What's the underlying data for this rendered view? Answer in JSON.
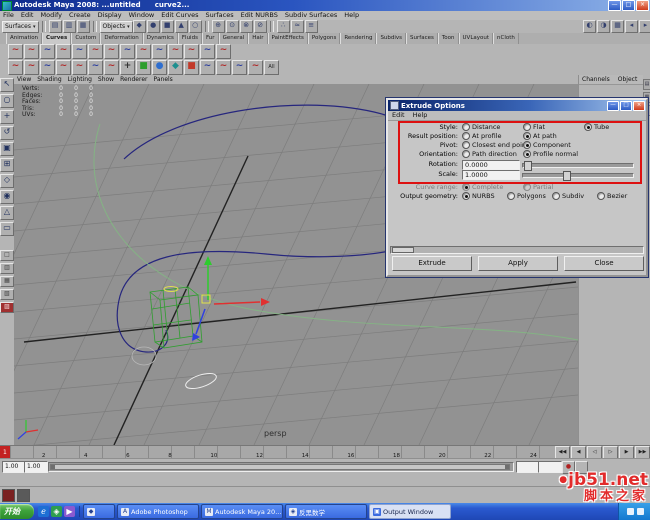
{
  "window": {
    "title": "Autodesk Maya 2008: ...untitled",
    "doc": "curve2...",
    "min_icon": "—",
    "max_icon": "□",
    "close_icon": "×"
  },
  "menubar": {
    "items": [
      "File",
      "Edit",
      "Modify",
      "Create",
      "Display",
      "Window",
      "Edit Curves",
      "Surfaces",
      "Edit NURBS",
      "Subdiv Surfaces",
      "Help"
    ]
  },
  "statusline": {
    "mode": "Surfaces",
    "mask": "Objects",
    "caret": "▾",
    "file_icons": [
      {
        "g": "▤"
      },
      {
        "g": "▥"
      },
      {
        "g": "▦"
      }
    ],
    "mask_icons": [
      {
        "g": "◆"
      },
      {
        "g": "●"
      },
      {
        "g": "■"
      },
      {
        "g": "▲"
      },
      {
        "g": "○"
      }
    ],
    "snap_icons": [
      {
        "g": "⊕"
      },
      {
        "g": "⊙"
      },
      {
        "g": "⊗"
      },
      {
        "g": "⊘"
      }
    ],
    "history_icons": [
      {
        "g": "∴"
      },
      {
        "g": "≈"
      },
      {
        "g": "≡"
      }
    ],
    "render_icons": [
      {
        "g": "◐"
      },
      {
        "g": "◑"
      },
      {
        "g": "▦"
      }
    ],
    "toggle_icons": [
      {
        "g": "◂"
      },
      {
        "g": "▸"
      }
    ]
  },
  "shelf": {
    "tabs": [
      {
        "t": "Animation"
      },
      {
        "t": "Curves",
        "cls": "on"
      },
      {
        "t": "Custom"
      },
      {
        "t": "Deformation"
      },
      {
        "t": "Dynamics"
      },
      {
        "t": "Fluids"
      },
      {
        "t": "Fur"
      },
      {
        "t": "General"
      },
      {
        "t": "Hair"
      },
      {
        "t": "PaintEffects"
      },
      {
        "t": "Polygons"
      },
      {
        "t": "Rendering"
      },
      {
        "t": "Subdivs"
      },
      {
        "t": "Surfaces"
      },
      {
        "t": "Toon"
      },
      {
        "t": "UVLayout"
      },
      {
        "t": "nCloth"
      }
    ],
    "row1": [
      {
        "g": "∼",
        "cls": "ci-red"
      },
      {
        "g": "∼",
        "cls": "ci-red"
      },
      {
        "g": "∼",
        "cls": "ci-blue"
      },
      {
        "g": "∼",
        "cls": "ci-red"
      },
      {
        "g": "∼",
        "cls": "ci-blue"
      },
      {
        "g": "∼",
        "cls": "ci-red"
      },
      {
        "g": "∼",
        "cls": "ci-red"
      },
      {
        "g": "∼",
        "cls": "ci-blue"
      },
      {
        "g": "∼",
        "cls": "ci-red"
      },
      {
        "g": "∼",
        "cls": "ci-blue"
      },
      {
        "g": "∼",
        "cls": "ci-red"
      },
      {
        "g": "∼",
        "cls": "ci-red"
      },
      {
        "g": "∼",
        "cls": "ci-blue"
      },
      {
        "g": "∼",
        "cls": "ci-red"
      }
    ],
    "row2": [
      {
        "g": "∼",
        "cls": "ci-red"
      },
      {
        "g": "∼",
        "cls": "ci-red"
      },
      {
        "g": "∼",
        "cls": "ci-blue"
      },
      {
        "g": "∼",
        "cls": "ci-red"
      },
      {
        "g": "∼",
        "cls": "ci-red"
      },
      {
        "g": "∼",
        "cls": "ci-blue"
      },
      {
        "g": "∼",
        "cls": "ci-red"
      },
      {
        "g": "+",
        "cls": "ci-dark"
      },
      {
        "g": "■",
        "cls": "ci-green"
      },
      {
        "g": "●",
        "cls": "ci-blue2"
      },
      {
        "g": "◆",
        "cls": "ci-teal"
      },
      {
        "g": "■",
        "cls": "ci-red2"
      },
      {
        "g": "∼",
        "cls": "ci-blue"
      },
      {
        "g": "∼",
        "cls": "ci-red"
      },
      {
        "g": "∼",
        "cls": "ci-blue"
      },
      {
        "g": "∼",
        "cls": "ci-red"
      },
      {
        "g": "All",
        "cls": "ci-txt"
      }
    ]
  },
  "toolbox": {
    "tools": [
      {
        "g": "↖"
      },
      {
        "g": "○"
      },
      {
        "g": "+"
      },
      {
        "g": "↺"
      },
      {
        "g": "▣"
      },
      {
        "g": "⊞"
      },
      {
        "g": "◇"
      },
      {
        "g": "◉"
      },
      {
        "g": "△"
      },
      {
        "g": "▭"
      }
    ],
    "layouts": [
      {
        "g": "□"
      },
      {
        "g": "▥"
      },
      {
        "g": "▦"
      },
      {
        "g": "▧"
      },
      {
        "g": "▨",
        "cls": "red"
      }
    ]
  },
  "panel_menu": {
    "items": [
      "View",
      "Shading",
      "Lighting",
      "Show",
      "Renderer",
      "Panels"
    ]
  },
  "hud": {
    "rows": [
      {
        "label": "Verts:",
        "a": "0",
        "b": "0",
        "c": "0"
      },
      {
        "label": "Edges:",
        "a": "0",
        "b": "0",
        "c": "0"
      },
      {
        "label": "Faces:",
        "a": "0",
        "b": "0",
        "c": "0"
      },
      {
        "label": "Tris:",
        "a": "0",
        "b": "0",
        "c": "0"
      },
      {
        "label": "UVs:",
        "a": "0",
        "b": "0",
        "c": "0"
      }
    ]
  },
  "viewport": {
    "camera_label": "persp"
  },
  "channel_box": {
    "menu": [
      "Channels",
      "Object"
    ],
    "side_icons": [
      {
        "g": "▤"
      },
      {
        "g": "▦"
      },
      {
        "g": "▧"
      }
    ]
  },
  "dialog": {
    "title": "Extrude Options",
    "min_icon": "—",
    "max_icon": "□",
    "close_icon": "×",
    "menu": [
      "Edit",
      "Help"
    ],
    "radio_rows": [
      {
        "label": "Style:",
        "options": [
          {
            "t": "Distance",
            "cls": ""
          },
          {
            "t": "Flat",
            "cls": ""
          },
          {
            "t": "Tube",
            "cls": "on"
          }
        ]
      },
      {
        "label": "Result position:",
        "options": [
          {
            "t": "At profile",
            "cls": ""
          },
          {
            "t": "At path",
            "cls": "on"
          }
        ]
      },
      {
        "label": "Pivot:",
        "options": [
          {
            "t": "Closest end point",
            "cls": ""
          },
          {
            "t": "Component",
            "cls": "on"
          }
        ]
      },
      {
        "label": "Orientation:",
        "options": [
          {
            "t": "Path direction",
            "cls": ""
          },
          {
            "t": "Profile normal",
            "cls": "on"
          }
        ]
      }
    ],
    "sliders": [
      {
        "label": "Rotation:",
        "value": "0.0000"
      },
      {
        "label": "Scale:",
        "value": "1.0000"
      }
    ],
    "curve_range": {
      "label": "Curve range:",
      "options": [
        {
          "t": "Complete",
          "cls": "on dim"
        },
        {
          "t": "Partial",
          "cls": "dim"
        }
      ]
    },
    "output_geometry": {
      "label": "Output geometry:",
      "options": [
        {
          "t": "NURBS",
          "cls": "on"
        },
        {
          "t": "Polygons",
          "cls": ""
        },
        {
          "t": "Subdiv",
          "cls": ""
        },
        {
          "t": "Bezier",
          "cls": ""
        }
      ]
    },
    "buttons": [
      "Extrude",
      "Apply",
      "Close"
    ]
  },
  "timeline": {
    "current": "1",
    "labels": [
      "2",
      "4",
      "6",
      "8",
      "10",
      "12",
      "14",
      "16",
      "18",
      "20",
      "22",
      "24"
    ],
    "playback_icons": [
      "◀◀",
      "◀",
      "◁",
      "▷",
      "▶",
      "▶▶"
    ]
  },
  "range": {
    "field1": "1.00",
    "field2": "1.00",
    "autokey_icon": "●"
  },
  "command_line": {
    "input": ""
  },
  "taskbar": {
    "start_label": "开始",
    "quick_icons": [
      {
        "g": "e",
        "cls": "q-ie"
      },
      {
        "g": "◈",
        "cls": "q-g"
      },
      {
        "g": "▶",
        "cls": "q-m"
      }
    ],
    "buttons": [
      {
        "icon": "◆",
        "label": "",
        "cls": "narrow"
      },
      {
        "icon": "A",
        "label": "Adobe Photoshop",
        "cls": ""
      },
      {
        "icon": "M",
        "label": "Autodesk Maya 20...",
        "cls": ""
      },
      {
        "icon": "◈",
        "label": "反黑数学",
        "cls": ""
      },
      {
        "icon": "▣",
        "label": "Output Window",
        "cls": "light"
      }
    ]
  },
  "watermark": {
    "dot": "●",
    "line1": "jb51.net",
    "line2": "脚本之家"
  }
}
